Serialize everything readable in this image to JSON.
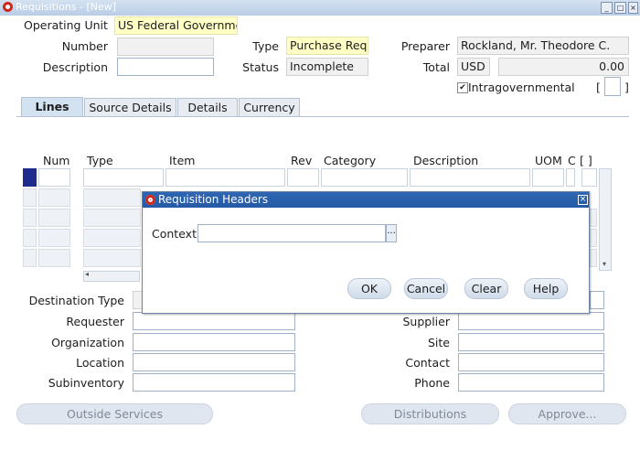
{
  "window": {
    "title": "Requisitions - [New]"
  },
  "header": {
    "operating_unit_label": "Operating Unit",
    "operating_unit_value": "US Federal Governme",
    "number_label": "Number",
    "number_value": "",
    "description_label": "Description",
    "description_value": "",
    "type_label": "Type",
    "type_value": "Purchase Requ",
    "status_label": "Status",
    "status_value": "Incomplete",
    "preparer_label": "Preparer",
    "preparer_value": "Rockland, Mr. Theodore C.",
    "total_label": "Total",
    "currency_value": "USD",
    "total_value": "0.00",
    "intragov_label": "Intragovernmental",
    "intragov_checked": true,
    "bracket_left": "[",
    "bracket_right": "]"
  },
  "tabs": [
    {
      "label": "Lines",
      "active": true
    },
    {
      "label": "Source Details",
      "active": false
    },
    {
      "label": "Details",
      "active": false
    },
    {
      "label": "Currency",
      "active": false
    }
  ],
  "lines_table": {
    "columns": [
      "Num",
      "Type",
      "Item",
      "Rev",
      "Category",
      "Description",
      "UOM",
      "C",
      "[ ]"
    ],
    "rows": [
      {
        "num": "",
        "type": "",
        "item": "",
        "rev": "",
        "category": "",
        "description": "",
        "uom": ""
      }
    ]
  },
  "bottom": {
    "destination_type_label": "Destination Type",
    "requester_label": "Requester",
    "organization_label": "Organization",
    "location_label": "Location",
    "subinventory_label": "Subinventory",
    "supplier_label": "Supplier",
    "site_label": "Site",
    "contact_label": "Contact",
    "phone_label": "Phone"
  },
  "buttons": {
    "outside_services": "Outside Services",
    "distributions": "Distributions",
    "approve": "Approve..."
  },
  "dialog": {
    "title": "Requisition Headers",
    "context_label": "Context",
    "context_value": "",
    "lov_label": "...",
    "ok": "OK",
    "cancel": "Cancel",
    "clear": "Clear",
    "help": "Help"
  },
  "colors": {
    "titlebar": "#b9cde6",
    "dialog_title": "#245aa5",
    "required_field": "#ffffc6",
    "current_record": "#1e2a8c"
  }
}
